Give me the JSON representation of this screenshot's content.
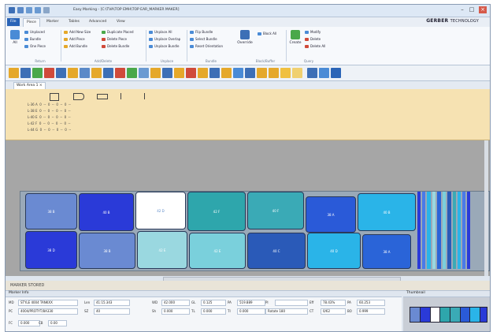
{
  "window": {
    "title": "Easy Marking - [C:\\TVA\\TOP EMH\\TOP EAR_MARKER MAKER]"
  },
  "tabs": [
    "File",
    "Piece",
    "Marker",
    "Tables",
    "Advanced",
    "View"
  ],
  "brand": {
    "name": "GERBER",
    "suffix": "TECHNOLOGY"
  },
  "ribbon": {
    "all_label": "All",
    "return_group": {
      "label": "Return",
      "items": [
        "Unplaced",
        "Bundle",
        "One Piece"
      ]
    },
    "add_delete_group": {
      "label": "Add/Delete",
      "items": [
        "Add New Size",
        "Add Piece",
        "Add Bundle",
        "Duplicate Placed",
        "Delete Piece",
        "Delete Bundle"
      ]
    },
    "unplace_group": {
      "label": "Unplace",
      "items": [
        "Unplace All",
        "Unplace Overlap",
        "Unplace Bundle"
      ]
    },
    "bundle_group": {
      "label": "Bundle",
      "items": [
        "Flip Bundle",
        "Select Bundle",
        "Reset Orientation"
      ]
    },
    "override_label": "Override",
    "block_buffer_group": {
      "label": "Block/Buffer",
      "items": [
        "Block All"
      ]
    },
    "query_group": {
      "label": "Query",
      "create_label": "Create",
      "items": [
        "Modify",
        "Delete",
        "Delete All"
      ]
    }
  },
  "document_tab": "Work Area 1",
  "piece_rows": [
    {
      "size": "L-36",
      "grade": "A",
      "vals": [
        "0",
        "--",
        "0",
        "--",
        "0",
        "--",
        "0",
        "--"
      ]
    },
    {
      "size": "L-38",
      "grade": "E",
      "vals": [
        "0",
        "--",
        "0",
        "--",
        "0",
        "--",
        "0",
        "--"
      ]
    },
    {
      "size": "L-40",
      "grade": "E",
      "vals": [
        "0",
        "--",
        "0",
        "--",
        "0",
        "--",
        "0",
        "--"
      ]
    },
    {
      "size": "L-42",
      "grade": "F",
      "vals": [
        "0",
        "--",
        "0",
        "--",
        "0",
        "--",
        "0",
        "--"
      ]
    },
    {
      "size": "L-44",
      "grade": "G",
      "vals": [
        "0",
        "--",
        "0",
        "--",
        "0",
        "--",
        "0",
        "--"
      ]
    }
  ],
  "marker_pieces": [
    {
      "label": "38 B"
    },
    {
      "label": "40 B"
    },
    {
      "label": "42 D"
    },
    {
      "label": "42 F"
    },
    {
      "label": "40 F"
    },
    {
      "label": "38 A"
    },
    {
      "label": "40 B"
    },
    {
      "label": "38 D"
    },
    {
      "label": "38 B"
    },
    {
      "label": "42 E"
    },
    {
      "label": "42 E"
    },
    {
      "label": "40 C"
    },
    {
      "label": "40 D"
    },
    {
      "label": "38 A"
    }
  ],
  "status_text": "MARKER STORED",
  "panels": {
    "marker_info": "Marker Info",
    "thumbnail": "Thumbnail"
  },
  "marker_info": {
    "md_label": "MD",
    "md_value": "STYLE 4004 TANKXX",
    "pc_label": "PC",
    "pc_value": "4004/PROTYT/8A330",
    "fc_label": "FC",
    "fc_value": "0.000",
    "len_label": "Len",
    "len_value": "41:15.343",
    "sz_label": "SZ",
    "sz_value": "40",
    "cb_label": "CB",
    "cb_value": "0.00",
    "wd_label": "WD",
    "wd_value": "42.000",
    "sh_label": "Sh",
    "sh_value": "0.000",
    "gl_label": "GL",
    "gl_value": "0.125",
    "tl_label": "TL",
    "tl_value": "0.000",
    "pa_label": "PA",
    "pa_value": "519.889",
    "ti_label": "TI",
    "ti_value": "0.000",
    "pi_label": "PI",
    "pi_value": "",
    "rotate_label": "Rotate 180",
    "eff_label": "Eff",
    "eff_value": "78.43%",
    "ct_label": "CT",
    "ct_value": "0/62",
    "pa2_label": "PA",
    "pa2_value": "60.253",
    "bo_label": "BO",
    "bo_value": "0.999"
  }
}
